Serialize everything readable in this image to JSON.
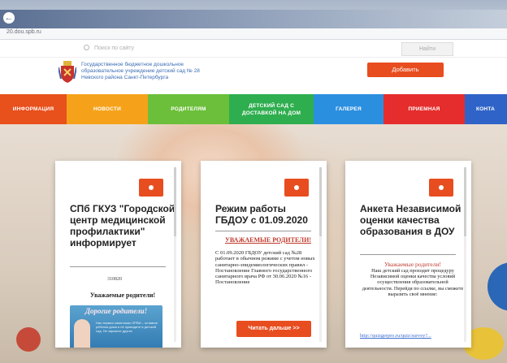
{
  "browser": {
    "url": "20.dou.spb.ru"
  },
  "header": {
    "search_placeholder": "Поиск по сайту",
    "search_button": "Найти",
    "org_name": "Государственное бюджетное дошкольное образовательное учреждение детский сад № 28 Невского района Санкт-Петербурга",
    "add_button": "Добавить"
  },
  "menu": {
    "items": [
      {
        "label": "Информация",
        "color": "#e8501c"
      },
      {
        "label": "Новости",
        "color": "#f5a21a"
      },
      {
        "label": "Родителям",
        "color": "#6bbf3a"
      },
      {
        "label": "Детский сад с доставкой на дом",
        "color": "#2fae4f"
      },
      {
        "label": "Галерея",
        "color": "#2b8fe0"
      },
      {
        "label": "Приемная",
        "color": "#e52d2d"
      },
      {
        "label": "Конта",
        "color": "#2f63c8"
      }
    ]
  },
  "cards": [
    {
      "title": "СПб ГКУЗ \"Городской центр медицинской профилактики\" информирует",
      "date": "310820",
      "greeting": "Уважаемые родители!",
      "banner_title": "Дорогие родители!",
      "banner_text": "Нас первых симптомах ОРВИ – оставьте ребенка дома и не приводите в детский сад. Не заразите других"
    },
    {
      "title": "Режим работы ГБДОУ с 01.09.2020",
      "subtitle": "УВАЖАЕМЫЕ РОДИТЕЛИ!",
      "body": "С 01.09.2020 ГБДОУ детский сад №28 работает в обычном режиме с учетом новых санитарно-эпидемиологических правил - Постановление Главного государственного санитарного врача РФ от 30.06.2020 №16 - Постановление",
      "button": "Читать дальше >>"
    },
    {
      "title": "Анкета Независимой оценки качества образования в ДОУ",
      "subtitle": "Уважаемые родители!",
      "body": "Наш детский сад проходит процедуру Независимой оценки качества условий осуществления образовательной деятельности. Перейдя по ссылке, вы сможете выразить своё мнение:",
      "link": "http://quizgerpro.ru/quiz/survey?..."
    }
  ],
  "colors": {
    "accent": "#e84d1f",
    "org_text": "#3c6cb4"
  }
}
